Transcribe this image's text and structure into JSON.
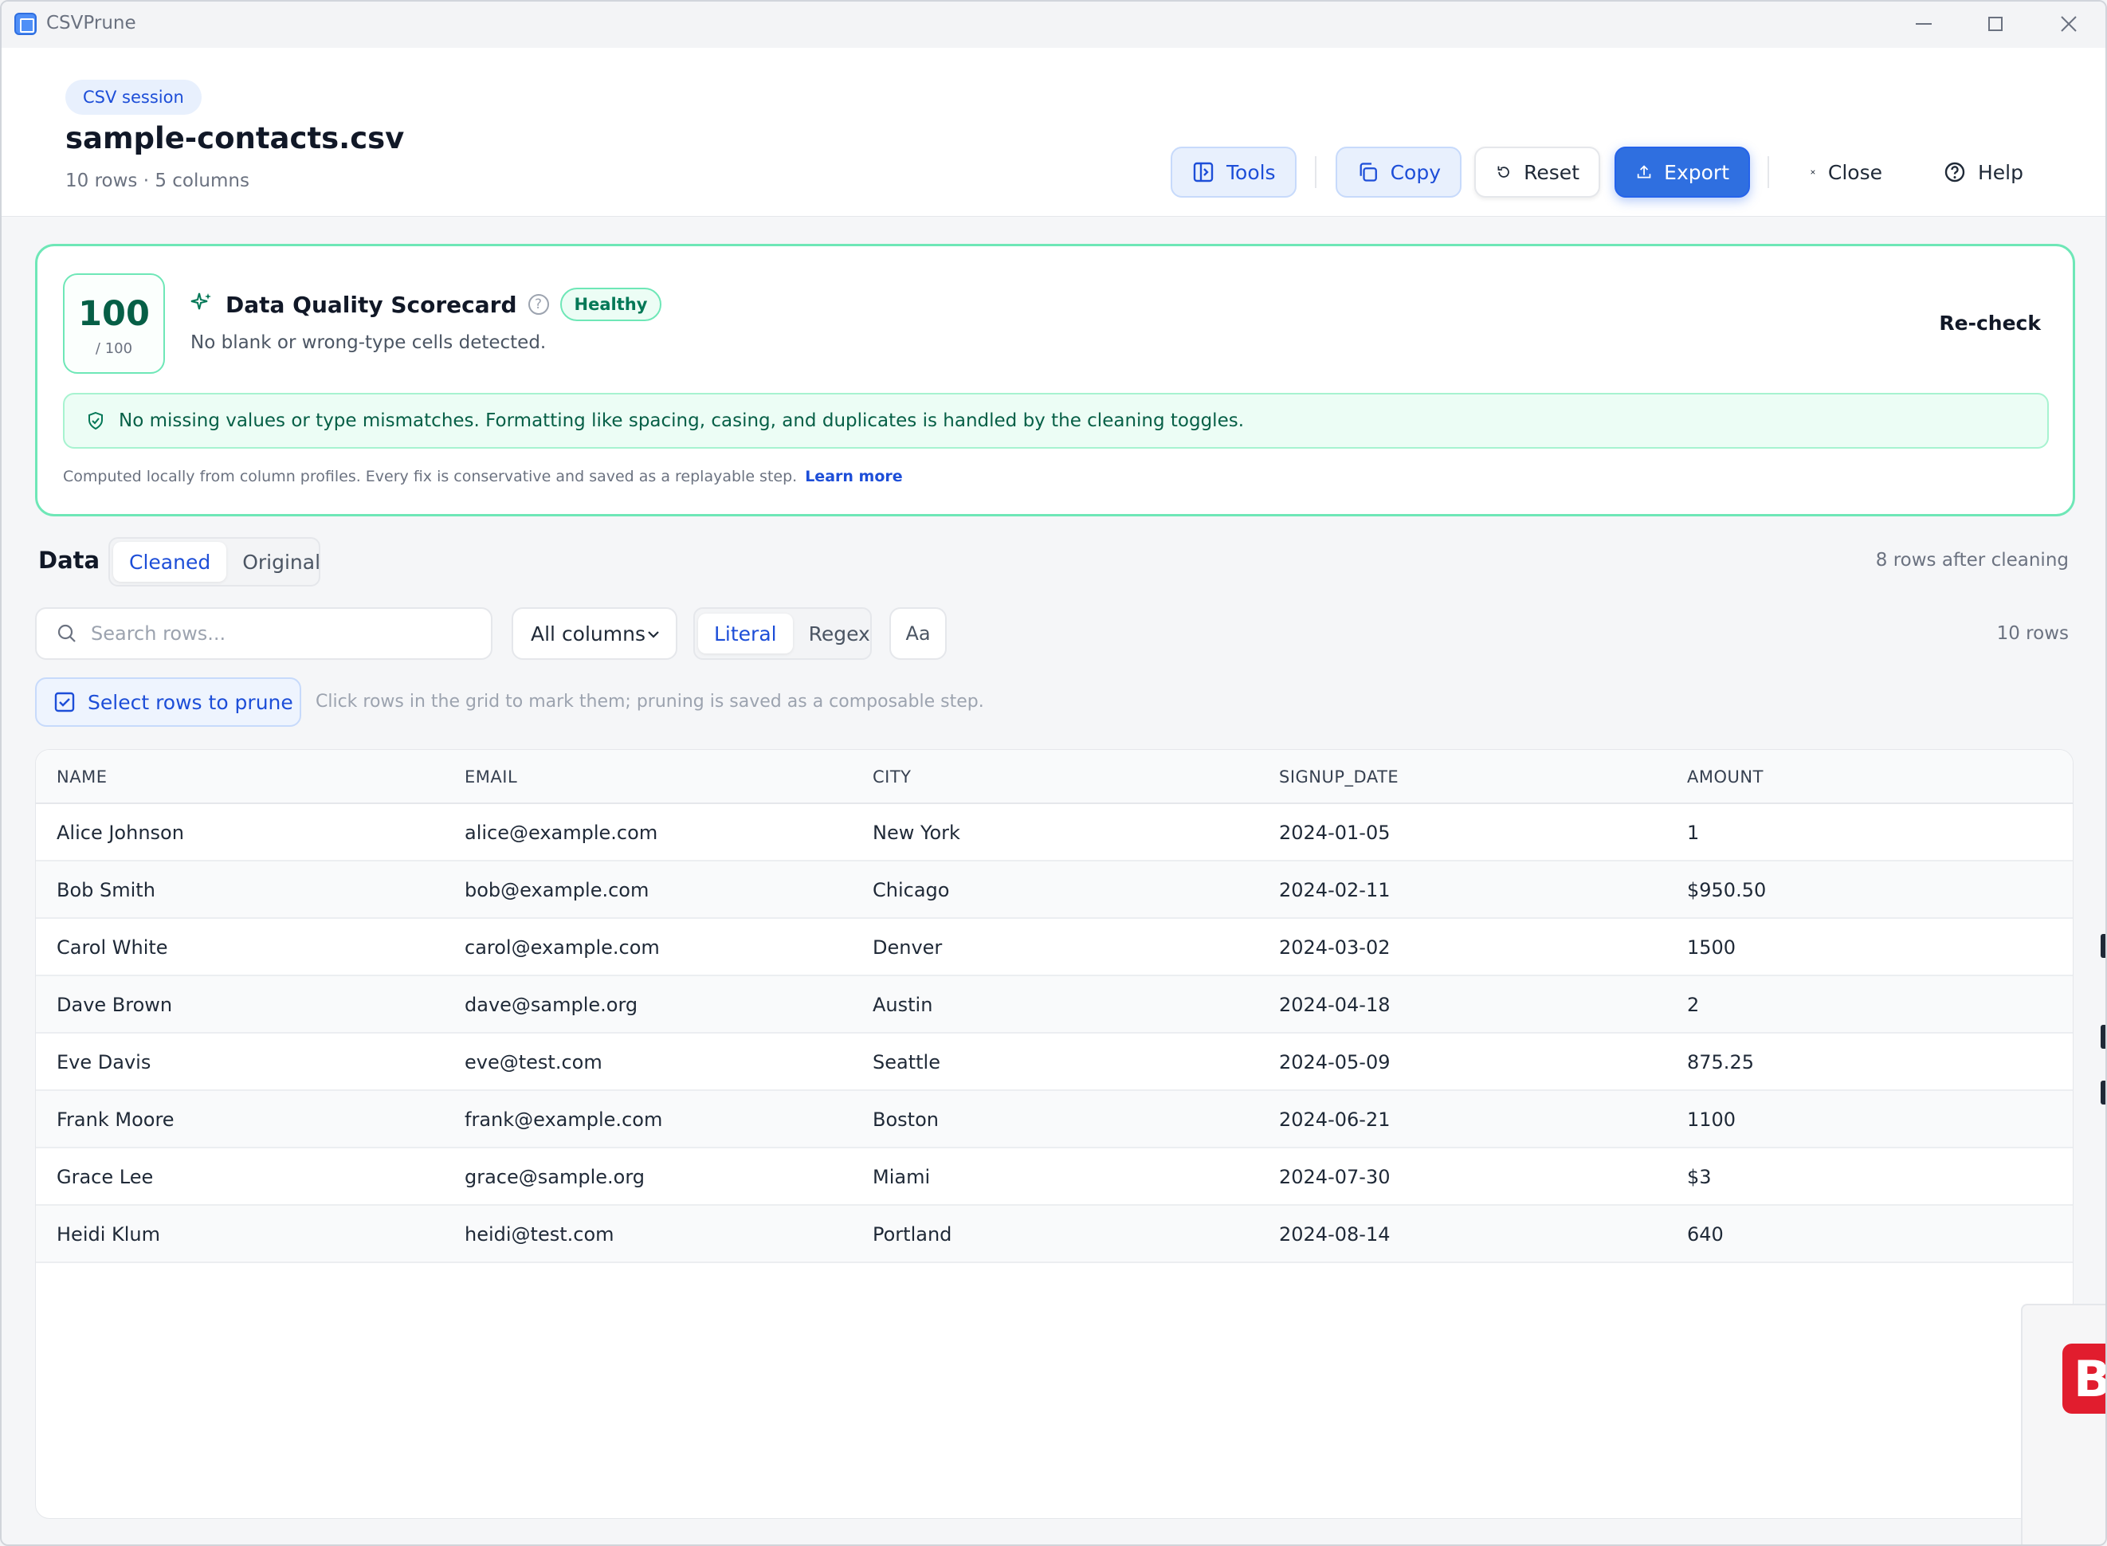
{
  "window": {
    "title": "CSVPrune"
  },
  "header": {
    "badge": "CSV session",
    "file_name": "sample-contacts.csv",
    "meta": "10 rows · 5 columns",
    "buttons": {
      "tools": "Tools",
      "copy": "Copy",
      "reset": "Reset",
      "export": "Export",
      "close": "Close",
      "help": "Help"
    }
  },
  "scorecard": {
    "score": "100",
    "max": "/ 100",
    "title": "Data Quality Scorecard",
    "status": "Healthy",
    "subtitle": "No blank or wrong-type cells detected.",
    "recheck": "Re-check",
    "notice": "No missing values or type mismatches. Formatting like spacing, casing, and duplicates is handled by the cleaning toggles.",
    "footnote": "Computed locally from column profiles. Every fix is conservative and saved as a replayable step.",
    "learn_more": "Learn more"
  },
  "data": {
    "label": "Data",
    "views": [
      "Cleaned",
      "Original"
    ],
    "active_view": "Cleaned",
    "rows_after": "8 rows after cleaning",
    "search_placeholder": "Search rows...",
    "column_filter": "All columns",
    "modes": [
      "Literal",
      "Regex"
    ],
    "active_mode": "Literal",
    "case_toggle": "Aa",
    "rows_count": "10 rows",
    "prune_button": "Select rows to prune",
    "prune_hint": "Click rows in the grid to mark them; pruning is saved as a composable step."
  },
  "table": {
    "columns": [
      "NAME",
      "EMAIL",
      "CITY",
      "SIGNUP_DATE",
      "AMOUNT"
    ],
    "rows": [
      [
        "Alice Johnson",
        "alice@example.com",
        "New York",
        "2024-01-05",
        "1"
      ],
      [
        "Bob Smith",
        "bob@example.com",
        "Chicago",
        "2024-02-11",
        "$950.50"
      ],
      [
        "Carol White",
        "carol@example.com",
        "Denver",
        "2024-03-02",
        "1500"
      ],
      [
        "Dave Brown",
        "dave@sample.org",
        "Austin",
        "2024-04-18",
        "2"
      ],
      [
        "Eve Davis",
        "eve@test.com",
        "Seattle",
        "2024-05-09",
        "875.25"
      ],
      [
        "Frank Moore",
        "frank@example.com",
        "Boston",
        "2024-06-21",
        "1100"
      ],
      [
        "Grace Lee",
        "grace@sample.org",
        "Miami",
        "2024-07-30",
        "$3"
      ],
      [
        "Heidi Klum",
        "heidi@test.com",
        "Portland",
        "2024-08-14",
        "640"
      ]
    ]
  },
  "overlay": {
    "logo_letter": "B"
  },
  "colors": {
    "accent": "#2f6fe0",
    "success": "#047857",
    "success_border": "#6ee7b7",
    "overlay_logo": "#e11d2e"
  }
}
